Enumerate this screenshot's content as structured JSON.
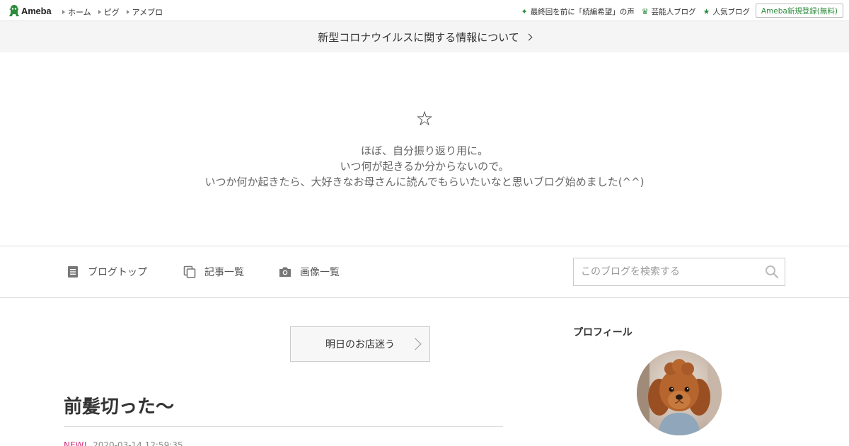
{
  "topbar": {
    "logo_text": "Ameba",
    "nav": [
      {
        "label": "ホーム"
      },
      {
        "label": "ピグ"
      },
      {
        "label": "アメブロ"
      }
    ],
    "right_nav": [
      {
        "icon": "sparkle-icon",
        "label": "最終回を前に「続編希望」の声"
      },
      {
        "icon": "crown-icon",
        "label": "芸能人ブログ"
      },
      {
        "icon": "star-icon",
        "label": "人気ブログ"
      }
    ],
    "signup_label": "Ameba新規登録(無料)",
    "accent_color": "#2d8c3c"
  },
  "notice": {
    "label": "新型コロナウイルスに関する情報について"
  },
  "header": {
    "title": "☆",
    "description": [
      "ほぼ、自分振り返り用に。",
      "いつ何が起きるか分からないので。",
      "いつか何か起きたら、大好きなお母さんに読んでもらいたいなと思いブログ始めました(^^)"
    ]
  },
  "blog_nav": {
    "items": [
      {
        "icon": "document-icon",
        "label": "ブログトップ"
      },
      {
        "icon": "copy-icon",
        "label": "記事一覧"
      },
      {
        "icon": "camera-icon",
        "label": "画像一覧"
      }
    ],
    "search_placeholder": "このブログを検索する"
  },
  "main": {
    "next_article_label": "明日のお店迷う",
    "article_title": "前髪切った〜",
    "new_badge": "NEW!",
    "article_date": "2020-03-14 12:59:35",
    "new_badge_color": "#d22d7a"
  },
  "sidebar": {
    "profile_heading": "プロフィール"
  }
}
